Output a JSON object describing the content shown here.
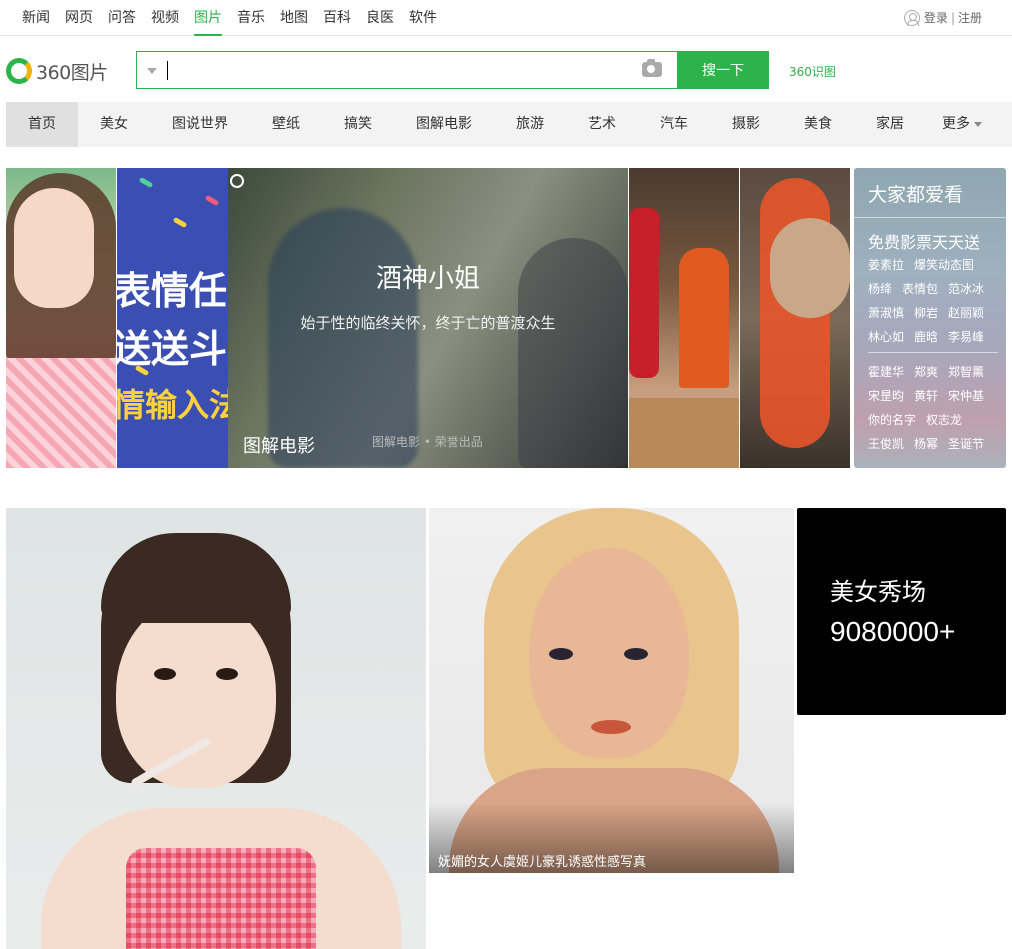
{
  "topnav": {
    "links": [
      "新闻",
      "网页",
      "问答",
      "视频",
      "图片",
      "音乐",
      "地图",
      "百科",
      "良医",
      "软件"
    ],
    "active": "图片",
    "login": "登录",
    "separator": "|",
    "register": "注册"
  },
  "logo": {
    "text": "360图片"
  },
  "search": {
    "value": "",
    "button": "搜一下",
    "shitu": "360识图"
  },
  "categories": [
    "首页",
    "美女",
    "图说世界",
    "壁纸",
    "搞笑",
    "图解电影",
    "旅游",
    "艺术",
    "汽车",
    "摄影",
    "美食",
    "家居",
    "更多"
  ],
  "banner": {
    "meme_lines": [
      "表情任",
      "送送斗",
      "情输入法"
    ],
    "movie": {
      "title": "酒神小姐",
      "subtitle": "始于性的临终关怀，终于亡的普渡众生",
      "category": "图解电影",
      "credit": "图解电影 • 荣誉出品"
    }
  },
  "hot": {
    "heading": "大家都爱看",
    "promo": "免费影票天天送",
    "rows1": [
      [
        "姜素拉",
        "爆笑动态图"
      ],
      [
        "杨绛",
        "表情包",
        "范冰冰"
      ],
      [
        "萧淑慎",
        "柳岩",
        "赵丽颖"
      ],
      [
        "林心如",
        "鹿晗",
        "李易峰"
      ]
    ],
    "rows2": [
      [
        "霍建华",
        "郑爽",
        "郑智薰"
      ],
      [
        "宋昰昀",
        "黄轩",
        "宋仲基"
      ],
      [
        "你的名字",
        "权志龙"
      ],
      [
        "王俊凯",
        "杨幂",
        "圣诞节"
      ]
    ]
  },
  "gallery": {
    "caption": "妩媚的女人虞姬儿豪乳诱惑性感写真",
    "show_title": "美女秀场",
    "show_count": "9080000+"
  }
}
